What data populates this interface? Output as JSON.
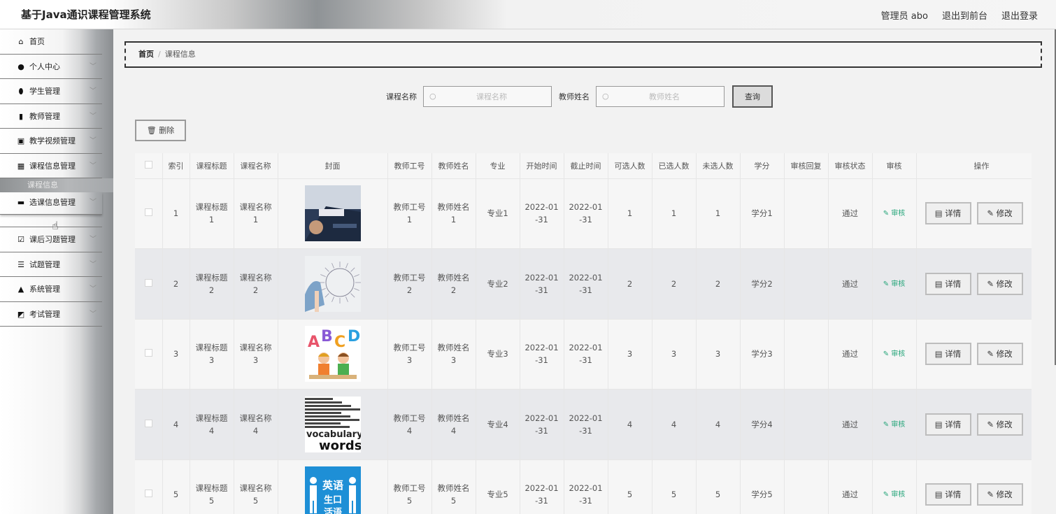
{
  "header": {
    "title": "基于Java通识课程管理系统",
    "admin": "管理员 abo",
    "back_front": "退出到前台",
    "logout": "退出登录"
  },
  "sidebar": {
    "items": [
      {
        "label": "首页",
        "icon": "home-icon",
        "glyph": "⌂",
        "chevron": false
      },
      {
        "label": "个人中心",
        "icon": "user-icon",
        "glyph": "●",
        "chevron": true
      },
      {
        "label": "学生管理",
        "icon": "location-pin-icon",
        "glyph": "⬮",
        "chevron": true
      },
      {
        "label": "教师管理",
        "icon": "bar-chart-icon",
        "glyph": "▮",
        "chevron": true
      },
      {
        "label": "教学视频管理",
        "icon": "video-icon",
        "glyph": "▣",
        "chevron": true
      },
      {
        "label": "课程信息管理",
        "icon": "grid-icon",
        "glyph": "▦",
        "chevron": true
      },
      {
        "label": "选课信息管理",
        "icon": "folder-icon",
        "glyph": "▬",
        "chevron": true
      },
      {
        "label": "课后习题管理",
        "icon": "check-square-icon",
        "glyph": "☑",
        "chevron": true
      },
      {
        "label": "试题管理",
        "icon": "sliders-icon",
        "glyph": "☰",
        "chevron": true
      },
      {
        "label": "系统管理",
        "icon": "settings-icon",
        "glyph": "▲",
        "chevron": true
      },
      {
        "label": "考试管理",
        "icon": "edit-square-icon",
        "glyph": "◩",
        "chevron": true
      }
    ],
    "sub_course_info": "课程信息"
  },
  "breadcrumb": {
    "home": "首页",
    "separator": "/",
    "current": "课程信息"
  },
  "search": {
    "course_name_label": "课程名称",
    "course_name_placeholder": "课程名称",
    "teacher_name_label": "教师姓名",
    "teacher_name_placeholder": "教师姓名",
    "button": "查询"
  },
  "toolbar": {
    "delete": "删除"
  },
  "table": {
    "columns": [
      "",
      "索引",
      "课程标题",
      "课程名称",
      "封面",
      "教师工号",
      "教师姓名",
      "专业",
      "开始时间",
      "截止时间",
      "可选人数",
      "已选人数",
      "未选人数",
      "学分",
      "审核回复",
      "审核状态",
      "审核",
      "操作"
    ],
    "rows": [
      {
        "index": "1",
        "title": "课程标题1",
        "name": "课程名称1",
        "cover": "cover-business-book",
        "teacher_no": "教师工号1",
        "teacher_name": "教师姓名1",
        "major": "专业1",
        "start": "2022-01-31",
        "end": "2022-01-31",
        "available": "1",
        "selected": "1",
        "unselected": "1",
        "credit": "学分1",
        "reply": "",
        "status": "通过",
        "review": "审核",
        "detail": "详情",
        "edit": "修改"
      },
      {
        "index": "2",
        "title": "课程标题2",
        "name": "课程名称2",
        "cover": "cover-business-training",
        "teacher_no": "教师工号2",
        "teacher_name": "教师姓名2",
        "major": "专业2",
        "start": "2022-01-31",
        "end": "2022-01-31",
        "available": "2",
        "selected": "2",
        "unselected": "2",
        "credit": "学分2",
        "reply": "",
        "status": "通过",
        "review": "审核",
        "detail": "详情",
        "edit": "修改"
      },
      {
        "index": "3",
        "title": "课程标题3",
        "name": "课程名称3",
        "cover": "cover-abcd-kids",
        "teacher_no": "教师工号3",
        "teacher_name": "教师姓名3",
        "major": "专业3",
        "start": "2022-01-31",
        "end": "2022-01-31",
        "available": "3",
        "selected": "3",
        "unselected": "3",
        "credit": "学分3",
        "reply": "",
        "status": "通过",
        "review": "审核",
        "detail": "详情",
        "edit": "修改"
      },
      {
        "index": "4",
        "title": "课程标题4",
        "name": "课程名称4",
        "cover": "cover-vocabulary-words",
        "teacher_no": "教师工号4",
        "teacher_name": "教师姓名4",
        "major": "专业4",
        "start": "2022-01-31",
        "end": "2022-01-31",
        "available": "4",
        "selected": "4",
        "unselected": "4",
        "credit": "学分4",
        "reply": "",
        "status": "通过",
        "review": "审核",
        "detail": "详情",
        "edit": "修改"
      },
      {
        "index": "5",
        "title": "课程标题5",
        "name": "课程名称5",
        "cover": "cover-english-oral",
        "teacher_no": "教师工号5",
        "teacher_name": "教师姓名5",
        "major": "专业5",
        "start": "2022-01-31",
        "end": "2022-01-31",
        "available": "5",
        "selected": "5",
        "unselected": "5",
        "credit": "学分5",
        "reply": "",
        "status": "通过",
        "review": "审核",
        "detail": "详情",
        "edit": "修改"
      }
    ]
  },
  "cover_text": {
    "abcd_letters": [
      "A",
      "B",
      "C",
      "D"
    ],
    "vocab_word1": "vocabulary",
    "vocab_word2": "words",
    "english_line1": "英语",
    "english_line2": "生口",
    "english_line3": "活语"
  },
  "colors": {
    "review_link": "#26a57a",
    "english_cover_bg": "#1e8fd6",
    "abcd": [
      "#e8546b",
      "#8a5ad6",
      "#f0a020",
      "#2aa0e0"
    ]
  }
}
